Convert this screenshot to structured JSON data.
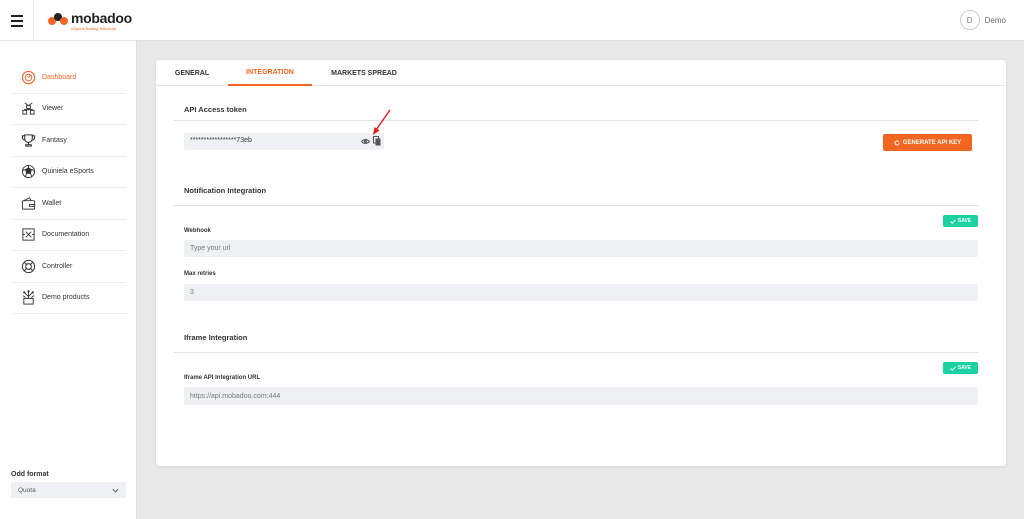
{
  "brand": {
    "name": "mobadoo",
    "tagline": "eSports Betting Solutions",
    "accent": "#f26522"
  },
  "user": {
    "initial": "D",
    "name": "Demo"
  },
  "sidebar": {
    "items": [
      {
        "label": "Dashboard",
        "icon": "dashboard-icon",
        "active": true
      },
      {
        "label": "Viewer",
        "icon": "viewer-icon"
      },
      {
        "label": "Fantasy",
        "icon": "trophy-icon"
      },
      {
        "label": "Quiniela eSports",
        "icon": "quiniela-icon"
      },
      {
        "label": "Wallet",
        "icon": "wallet-icon"
      },
      {
        "label": "Documentation",
        "icon": "documentation-icon"
      },
      {
        "label": "Controller",
        "icon": "controller-icon"
      },
      {
        "label": "Demo products",
        "icon": "demo-products-icon"
      }
    ],
    "odd_format": {
      "label": "Odd format",
      "value": "Quota"
    }
  },
  "tabs": [
    {
      "label": "GENERAL"
    },
    {
      "label": "INTEGRATION",
      "active": true
    },
    {
      "label": "MARKETS SPREAD"
    }
  ],
  "api": {
    "title": "API Access token",
    "token": "*****************73eb",
    "generate_label": "GENERATE API KEY"
  },
  "notification": {
    "title": "Notification Integration",
    "save_label": "SAVE",
    "webhook_label": "Webhook",
    "webhook_placeholder": "Type your url",
    "retries_label": "Max retries",
    "retries_value": "3"
  },
  "iframe": {
    "title": "Iframe Integration",
    "save_label": "SAVE",
    "url_label": "Iframe API Integration URL",
    "url_value": "https://api.mobadoo.com:444"
  },
  "colors": {
    "save_green": "#1dd0a0",
    "input_bg": "#eef0f3",
    "annotation_red": "#e02020"
  }
}
